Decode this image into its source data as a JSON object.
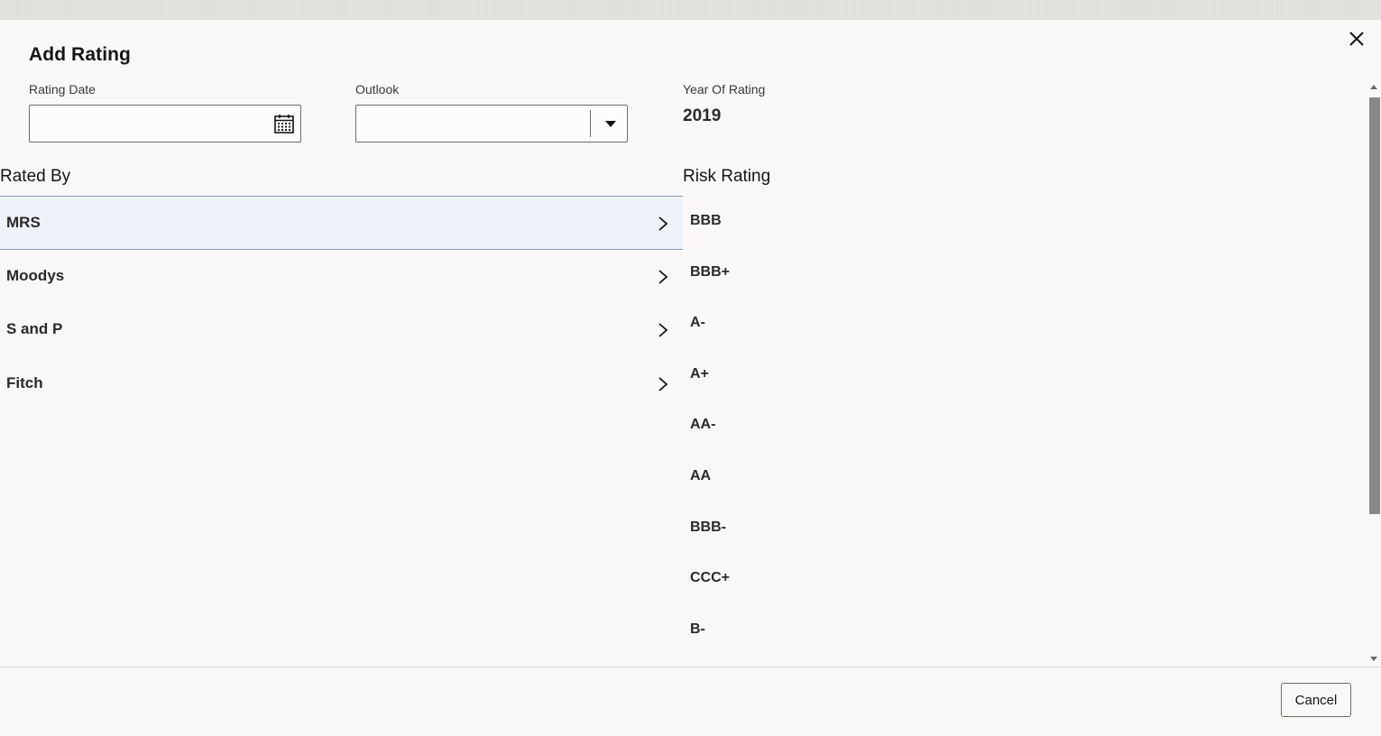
{
  "dialog": {
    "title": "Add Rating",
    "close_icon": "close-icon"
  },
  "fields": {
    "rating_date": {
      "label": "Rating Date",
      "value": "",
      "icon": "calendar-icon"
    },
    "outlook": {
      "label": "Outlook",
      "value": "",
      "icon": "chevron-down-icon"
    },
    "year_of_rating": {
      "label": "Year Of Rating",
      "value": "2019"
    }
  },
  "rated_by": {
    "heading": "Rated By",
    "selected_index": 0,
    "items": [
      {
        "label": "MRS"
      },
      {
        "label": "Moodys"
      },
      {
        "label": "S and P"
      },
      {
        "label": "Fitch"
      }
    ]
  },
  "risk_rating": {
    "heading": "Risk Rating",
    "items": [
      {
        "label": "BBB"
      },
      {
        "label": "BBB+"
      },
      {
        "label": "A-"
      },
      {
        "label": "A+"
      },
      {
        "label": "AA-"
      },
      {
        "label": "AA"
      },
      {
        "label": "BBB-"
      },
      {
        "label": "CCC+"
      },
      {
        "label": "B-"
      }
    ]
  },
  "footer": {
    "cancel_label": "Cancel"
  },
  "colors": {
    "selected_row_bg": "#eef2f9",
    "selected_row_border": "#8c97b6",
    "background": "#f9f8f6"
  }
}
